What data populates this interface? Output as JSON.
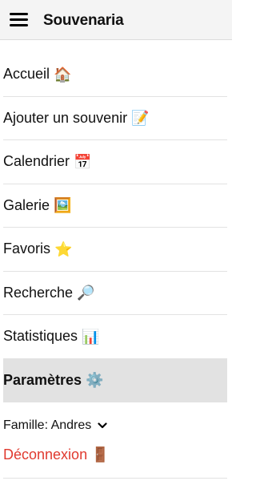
{
  "header": {
    "title": "Souvenaria"
  },
  "nav": {
    "items": [
      {
        "label": "Accueil",
        "emoji": "🏠"
      },
      {
        "label": "Ajouter un souvenir",
        "emoji": "📝"
      },
      {
        "label": "Calendrier",
        "emoji": "📅"
      },
      {
        "label": "Galerie",
        "emoji": "🖼️"
      },
      {
        "label": "Favoris",
        "emoji": "⭐"
      },
      {
        "label": "Recherche",
        "emoji": "🔎"
      },
      {
        "label": "Statistiques",
        "emoji": "📊"
      },
      {
        "label": "Paramètres",
        "emoji": "⚙️"
      }
    ],
    "active_index": 7
  },
  "family": {
    "label": "Famille: Andres"
  },
  "logout": {
    "label": "Déconnexion",
    "emoji": "🚪",
    "color": "#e03a2f"
  },
  "colors": {
    "header_bg": "#f4f4f4",
    "active_bg": "#e2e2e2",
    "divider": "#e2e2e2"
  }
}
